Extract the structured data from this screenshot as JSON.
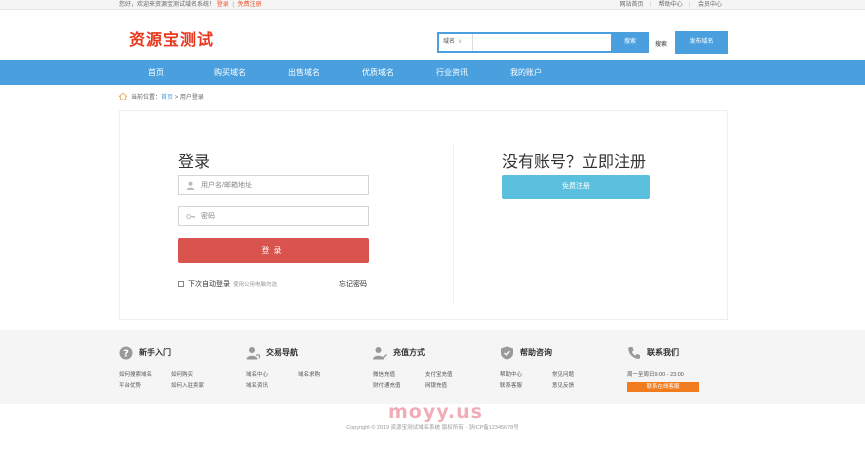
{
  "topbar": {
    "greeting": "您好，欢迎来资源宝测试域名系统！",
    "login_link": "登录",
    "register_link": "免费注册",
    "right_links": [
      "网站首页",
      "帮助中心",
      "会员中心"
    ]
  },
  "header": {
    "logo_text": "资源宝测试",
    "search_type": "域名",
    "search_placeholder": "",
    "search_button": "搜索",
    "advanced_link": "搜索",
    "publish_button": "发布域名"
  },
  "nav": {
    "items": [
      "首页",
      "购买域名",
      "出售域名",
      "优质域名",
      "行业资讯",
      "我的账户"
    ]
  },
  "breadcrumb": {
    "prefix": "当前位置：",
    "home": "首页",
    "separator": " > ",
    "current": "用户登录"
  },
  "login": {
    "title": "登录",
    "username_placeholder": "用户名/邮箱地址",
    "password_placeholder": "密码",
    "login_button": "登录",
    "remember_label": "下次自动登录",
    "remember_hint": "使用公用电脑勿选",
    "forgot_link": "忘记密码"
  },
  "register": {
    "title": "没有账号？立即注册",
    "register_button": "免费注册"
  },
  "footer": {
    "columns": [
      {
        "title": "新手入门",
        "links": [
          "如何搜索域名",
          "如何购买",
          "平台优势",
          "如何入驻卖家"
        ]
      },
      {
        "title": "交易导航",
        "links": [
          "域名中心",
          "域名求购",
          "域名资讯"
        ]
      },
      {
        "title": "充值方式",
        "links": [
          "微信充值",
          "支付宝充值",
          "财付通充值",
          "网银充值"
        ]
      },
      {
        "title": "帮助咨询",
        "links": [
          "帮助中心",
          "常见问题",
          "联系客服",
          "意见反馈"
        ]
      }
    ],
    "contact": {
      "title": "联系我们",
      "hours": "周一至周日9:00 - 23:00",
      "qq_button": "联系在线客服"
    }
  },
  "watermark": "moyy.us",
  "copyright": "Copyright © 2019 资源宝测试域名系统 版权所有 · 浙ICP备12345678号"
}
